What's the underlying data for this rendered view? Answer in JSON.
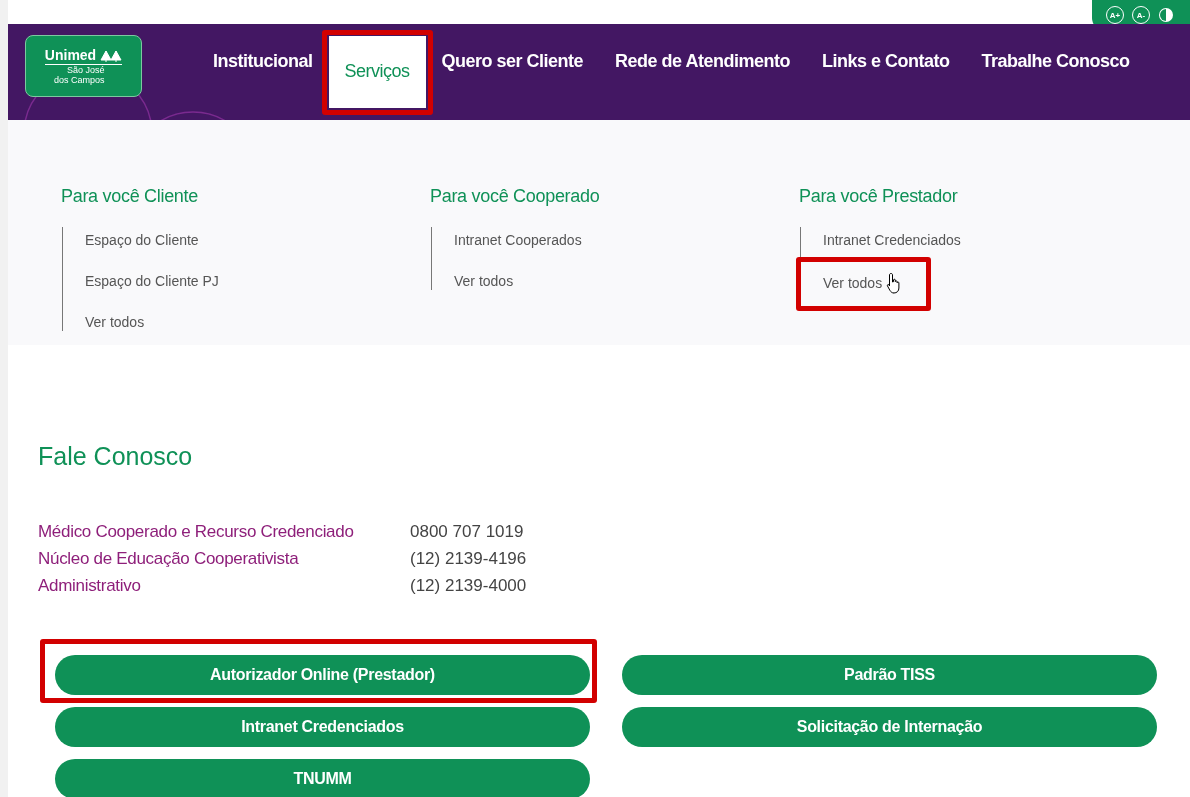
{
  "accessibility": {
    "buttons": [
      "A+",
      "A-"
    ]
  },
  "logo": {
    "name": "Unimed",
    "subtitle": [
      "São José",
      "dos Campos"
    ]
  },
  "nav": [
    {
      "label": "Institucional",
      "selected": false,
      "highlighted": false
    },
    {
      "label": "Serviços",
      "selected": true,
      "highlighted": true
    },
    {
      "label": "Quero ser Cliente",
      "selected": false,
      "highlighted": false
    },
    {
      "label": "Rede de Atendimento",
      "selected": false,
      "highlighted": false
    },
    {
      "label": "Links e Contato",
      "selected": false,
      "highlighted": false
    },
    {
      "label": "Trabalhe Conosco",
      "selected": false,
      "highlighted": false
    }
  ],
  "menu_columns": [
    {
      "title": "Para você Cliente",
      "links": [
        {
          "label": "Espaço do Cliente",
          "highlighted": false
        },
        {
          "label": "Espaço do Cliente PJ",
          "highlighted": false
        },
        {
          "label": "Ver todos",
          "highlighted": false
        }
      ]
    },
    {
      "title": "Para você Cooperado",
      "links": [
        {
          "label": "Intranet Cooperados",
          "highlighted": false
        },
        {
          "label": "Ver todos",
          "highlighted": false
        }
      ]
    },
    {
      "title": "Para você Prestador",
      "links": [
        {
          "label": "Intranet Credenciados",
          "highlighted": false
        },
        {
          "label": "Ver todos",
          "highlighted": true
        }
      ]
    }
  ],
  "contact": {
    "title": "Fale Conosco",
    "rows": [
      {
        "label": "Médico Cooperado e Recurso Credenciado",
        "phone": "0800 707 1019"
      },
      {
        "label": "Núcleo de Educação Cooperativista",
        "phone": "(12) 2139-4196"
      },
      {
        "label": "Administrativo",
        "phone": "(12) 2139-4000"
      }
    ]
  },
  "buttons": [
    {
      "label": "Autorizador Online (Prestador)",
      "highlighted": true
    },
    {
      "label": "Padrão TISS",
      "highlighted": false
    },
    {
      "label": "Intranet Credenciados",
      "highlighted": false
    },
    {
      "label": "Solicitação de Internação",
      "highlighted": false
    },
    {
      "label": "TNUMM",
      "highlighted": false
    }
  ]
}
